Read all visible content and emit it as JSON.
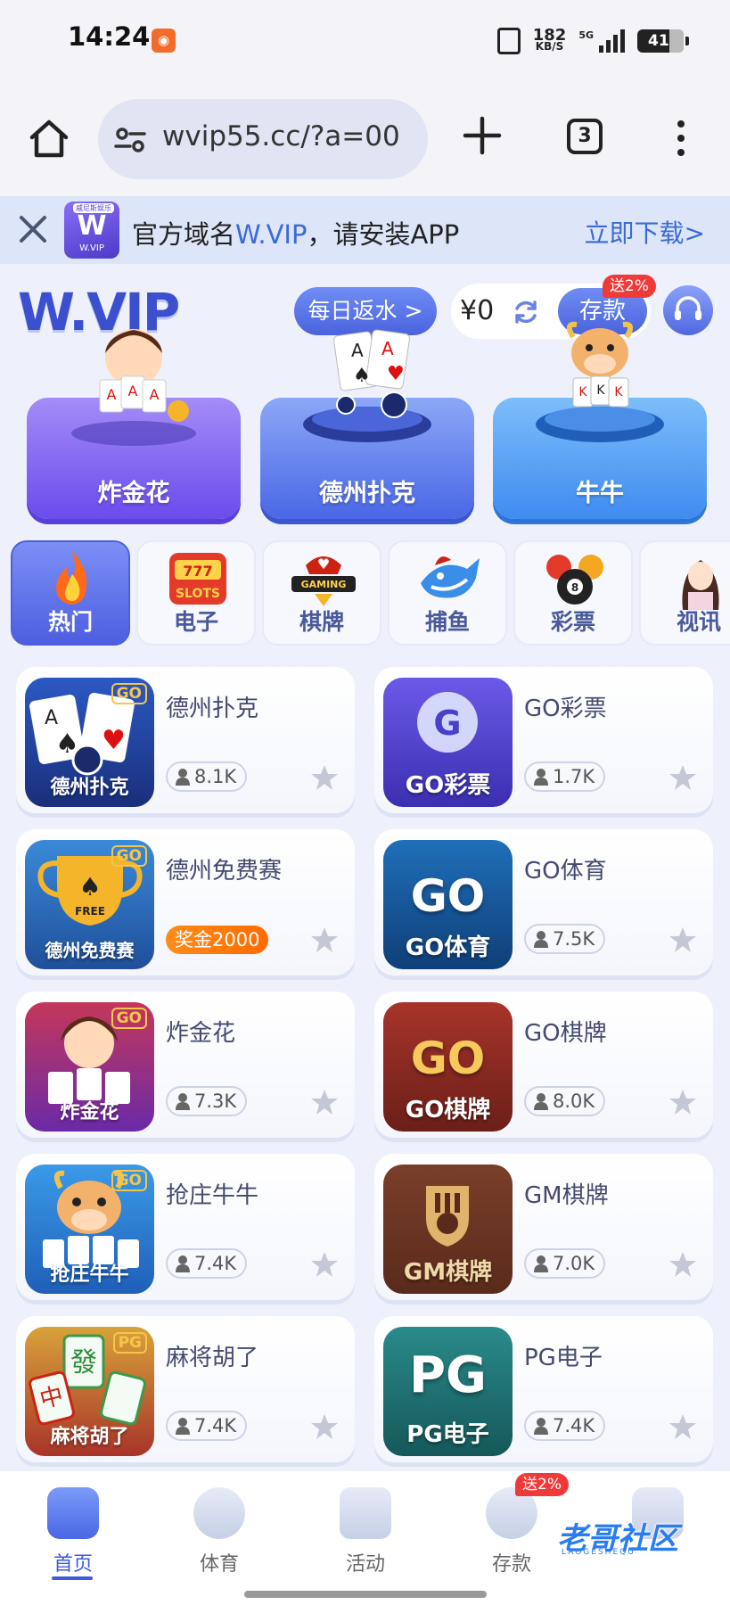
{
  "status_bar": {
    "time": "14:24",
    "net_speed_value": "182",
    "net_speed_unit": "KB/S",
    "network": "5G",
    "battery": "41"
  },
  "browser": {
    "url": "wvip55.cc/?a=00",
    "tab_count": "3"
  },
  "install_banner": {
    "brand_text": "W",
    "brand_sub": "W.VIP",
    "brand_tag": "威尼斯娱乐",
    "text_pre": "官方域名",
    "text_hl": "W.VIP",
    "text_post": "，请安装APP",
    "download": "立即下载>"
  },
  "header": {
    "logo": "W.VIP",
    "rebate": "每日返水 >",
    "balance": "¥0",
    "deposit": "存款",
    "deposit_badge": "送2%"
  },
  "featured": [
    {
      "label": "炸金花"
    },
    {
      "label": "德州扑克"
    },
    {
      "label": "牛牛"
    }
  ],
  "categories": [
    {
      "label": "热门",
      "icon": "fire-icon"
    },
    {
      "label": "电子",
      "icon": "slots-icon"
    },
    {
      "label": "棋牌",
      "icon": "cards-gaming-icon"
    },
    {
      "label": "捕鱼",
      "icon": "shark-icon"
    },
    {
      "label": "彩票",
      "icon": "lottery-balls-icon"
    },
    {
      "label": "视讯",
      "icon": "live-dealer-icon"
    }
  ],
  "games": [
    {
      "name": "德州扑克",
      "thumb_label": "德州扑克",
      "tag": "GO",
      "count": "8.1K"
    },
    {
      "name": "GO彩票",
      "thumb_label": "GO彩票",
      "tag": "",
      "count": "1.7K"
    },
    {
      "name": "德州免费赛",
      "thumb_label": "德州免费赛",
      "tag": "GO",
      "bonus": "奖金2000"
    },
    {
      "name": "GO体育",
      "thumb_label": "GO体育",
      "tag": "",
      "count": "7.5K"
    },
    {
      "name": "炸金花",
      "thumb_label": "炸金花",
      "tag": "GO",
      "count": "7.3K"
    },
    {
      "name": "GO棋牌",
      "thumb_label": "GO棋牌",
      "tag": "",
      "count": "8.0K"
    },
    {
      "name": "抢庄牛牛",
      "thumb_label": "抢庄牛牛",
      "tag": "GO",
      "count": "7.4K"
    },
    {
      "name": "GM棋牌",
      "thumb_label": "GM棋牌",
      "tag": "",
      "count": "7.0K"
    },
    {
      "name": "麻将胡了",
      "thumb_label": "麻将胡了",
      "tag": "PG",
      "count": "7.4K"
    },
    {
      "name": "PG电子",
      "thumb_label": "PG电子",
      "tag": "",
      "count": "7.4K"
    }
  ],
  "thumb_texts": {
    "free": "FREE",
    "go": "GO",
    "pg": "PG"
  },
  "bottom_nav": [
    {
      "label": "首页"
    },
    {
      "label": "体育"
    },
    {
      "label": "活动"
    },
    {
      "label": "存款"
    },
    {
      "label": ""
    }
  ],
  "nav_badge": "送2%",
  "watermark": {
    "text": "老哥社区",
    "sub": "LAOGESHEQU"
  },
  "colors": {
    "brand": "#3b4fcf",
    "accent_blue": "#4a67e6",
    "badge_red": "#f03a3a",
    "bonus_orange": "#ff7a0a"
  }
}
